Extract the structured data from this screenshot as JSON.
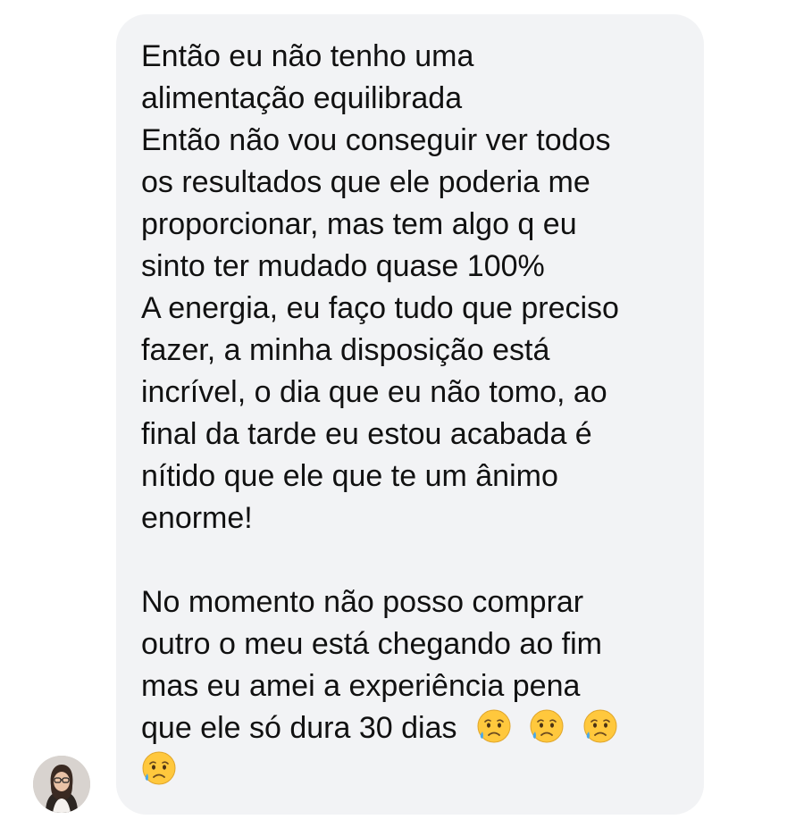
{
  "message": {
    "lines": [
      "Então eu não tenho uma",
      "alimentação equilibrada",
      "Então não vou conseguir ver todos",
      "os resultados que ele poderia me",
      "proporcionar, mas tem algo q eu",
      "sinto ter mudado quase 100%",
      "A energia, eu faço tudo que preciso",
      "fazer, a minha disposição está",
      "incrível, o dia que eu não tomo, ao",
      "final da tarde eu estou acabada é",
      "nítido que ele que te um ânimo",
      "enorme!",
      "",
      "No momento não posso comprar",
      "outro o meu está chegando ao fim",
      "mas eu amei a experiência pena",
      "que ele só dura 30 dias"
    ],
    "emoji_name": "sad-but-relieved-face-icon",
    "emoji_count": 4
  },
  "colors": {
    "bubble_background": "#f2f3f5",
    "text": "#111111",
    "emoji_face": "#ffc83d",
    "emoji_tear": "#4aa8e8"
  },
  "avatar": {
    "icon": "user-avatar"
  }
}
